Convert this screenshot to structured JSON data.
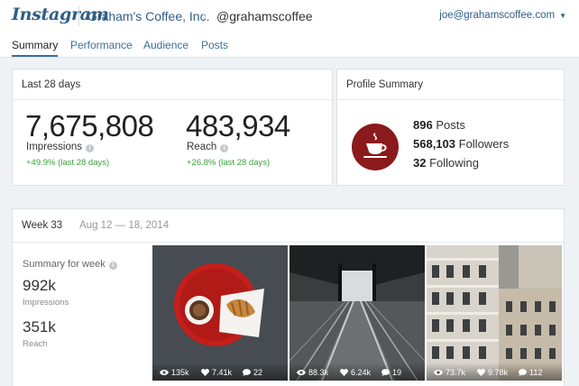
{
  "header": {
    "logo": "Instagram",
    "company": "Graham's Coffee, Inc.",
    "handle": "@grahamscoffee",
    "account_email": "joe@grahamscoffee.com",
    "account_caret": "▼",
    "breadcrumb_chevron": "›"
  },
  "tabs": [
    {
      "label": "Summary",
      "active": true
    },
    {
      "label": "Performance",
      "active": false
    },
    {
      "label": "Audience",
      "active": false
    },
    {
      "label": "Posts",
      "active": false
    }
  ],
  "last28": {
    "title": "Last 28 days",
    "impressions": {
      "value": "7,675,808",
      "label": "Impressions",
      "delta": "+49.9% (last 28 days)"
    },
    "reach": {
      "value": "483,934",
      "label": "Reach",
      "delta": "+26.8% (last 28 days)"
    }
  },
  "profile": {
    "title": "Profile Summary",
    "posts": {
      "count": "896",
      "label": "Posts"
    },
    "followers": {
      "count": "568,103",
      "label": "Followers"
    },
    "following": {
      "count": "32",
      "label": "Following"
    }
  },
  "week": {
    "title": "Week 33",
    "range": "Aug 12 — 18, 2014",
    "summary_title": "Summary for week",
    "impressions": {
      "value": "992k",
      "label": "Impressions"
    },
    "reach": {
      "value": "351k",
      "label": "Reach"
    }
  },
  "posts": [
    {
      "views": "135k",
      "likes": "7.41k",
      "comments": "22"
    },
    {
      "views": "88.3k",
      "likes": "6.24k",
      "comments": "19"
    },
    {
      "views": "73.7k",
      "likes": "9.78k",
      "comments": "112"
    }
  ],
  "icons": {
    "info": "info-icon",
    "views": "eye-icon",
    "likes": "heart-icon",
    "comments": "comment-icon"
  },
  "colors": {
    "accent": "#2e5e86",
    "positive": "#3aa03e",
    "avatar": "#8a1a1c"
  }
}
